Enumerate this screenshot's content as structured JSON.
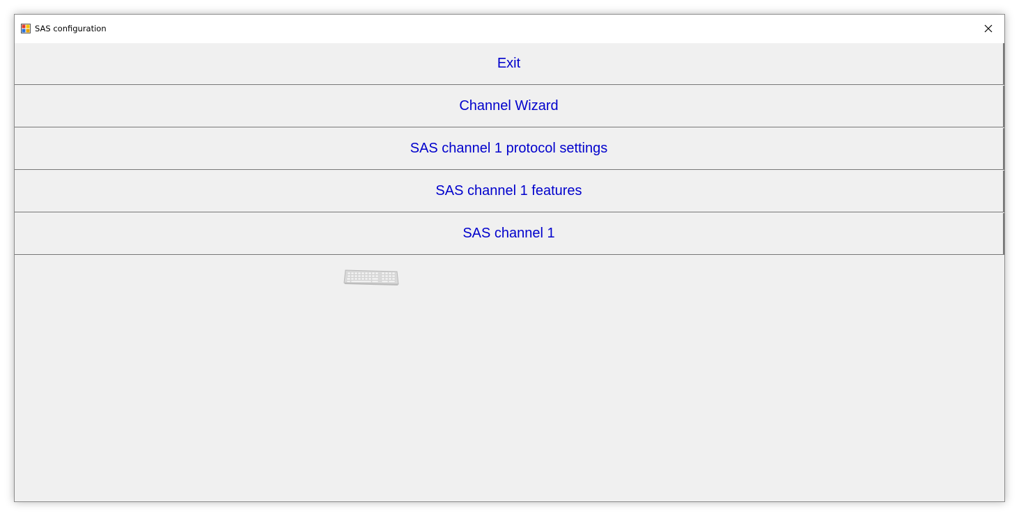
{
  "window": {
    "title": "SAS configuration",
    "icons": {
      "app": "app-window-icon",
      "close": "close-icon",
      "keyboard": "keyboard-icon"
    }
  },
  "menu": {
    "buttons": [
      {
        "label": "Exit"
      },
      {
        "label": "Channel Wizard"
      },
      {
        "label": "SAS channel 1 protocol settings"
      },
      {
        "label": "SAS channel 1 features"
      },
      {
        "label": "SAS channel 1"
      }
    ]
  },
  "colors": {
    "button_text": "#0000cc",
    "background": "#f0f0f0",
    "border": "#777777"
  }
}
